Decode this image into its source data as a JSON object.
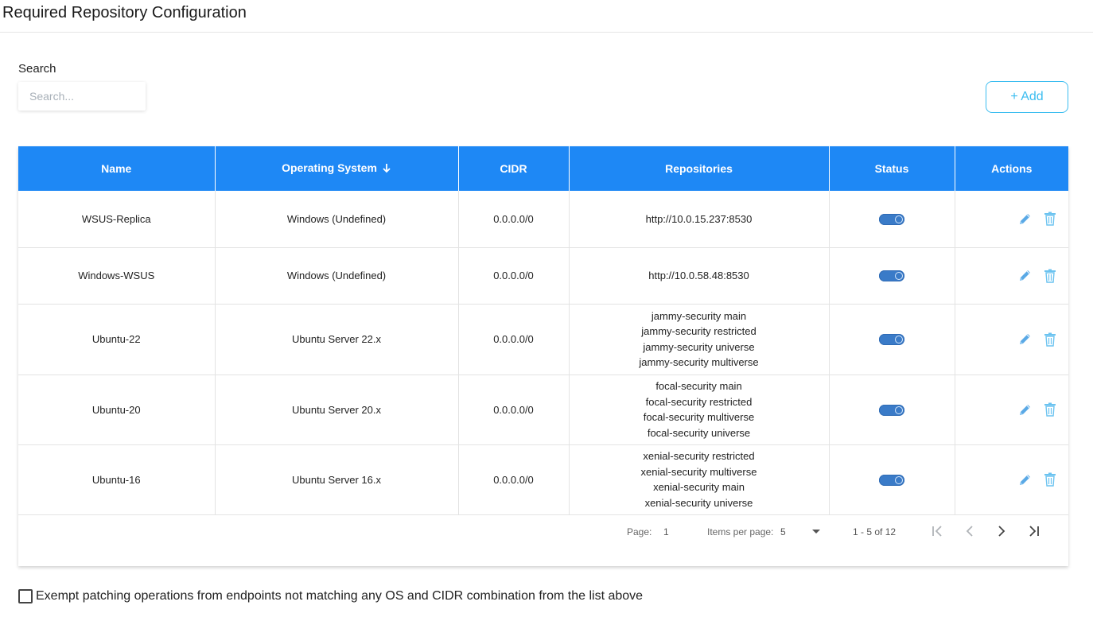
{
  "page": {
    "title": "Required Repository Configuration"
  },
  "search": {
    "label": "Search",
    "placeholder": "Search...",
    "value": ""
  },
  "toolbar": {
    "add_label": "+ Add"
  },
  "colors": {
    "header_bg": "#1e88f5",
    "accent": "#3cbdf0",
    "toggle": "#3a7bc8"
  },
  "table": {
    "columns": [
      "Name",
      "Operating System",
      "CIDR",
      "Repositories",
      "Status",
      "Actions"
    ],
    "sort": {
      "column": "Operating System",
      "direction": "descending",
      "icon": "arrow-down-icon"
    },
    "rows": [
      {
        "name": "WSUS-Replica",
        "os": "Windows (Undefined)",
        "cidr": "0.0.0.0/0",
        "repositories": [
          "http://10.0.15.237:8530"
        ],
        "status": "enabled"
      },
      {
        "name": "Windows-WSUS",
        "os": "Windows (Undefined)",
        "cidr": "0.0.0.0/0",
        "repositories": [
          "http://10.0.58.48:8530"
        ],
        "status": "enabled"
      },
      {
        "name": "Ubuntu-22",
        "os": "Ubuntu Server 22.x",
        "cidr": "0.0.0.0/0",
        "repositories": [
          "jammy-security main",
          "jammy-security restricted",
          "jammy-security universe",
          "jammy-security multiverse"
        ],
        "status": "enabled"
      },
      {
        "name": "Ubuntu-20",
        "os": "Ubuntu Server 20.x",
        "cidr": "0.0.0.0/0",
        "repositories": [
          "focal-security main",
          "focal-security restricted",
          "focal-security multiverse",
          "focal-security universe"
        ],
        "status": "enabled"
      },
      {
        "name": "Ubuntu-16",
        "os": "Ubuntu Server 16.x",
        "cidr": "0.0.0.0/0",
        "repositories": [
          "xenial-security restricted",
          "xenial-security multiverse",
          "xenial-security main",
          "xenial-security universe"
        ],
        "status": "enabled"
      }
    ],
    "row_actions": [
      "pencil-icon",
      "trash-icon"
    ]
  },
  "paginator": {
    "page_label": "Page:",
    "page_value": "1",
    "items_per_page_label": "Items per page:",
    "items_per_page_value": "5",
    "range": "1 - 5 of 12",
    "buttons": [
      "first-page-icon",
      "previous-page-icon",
      "next-page-icon",
      "last-page-icon"
    ]
  },
  "exempt": {
    "label": "Exempt patching operations from endpoints not matching any OS and CIDR combination from the list above",
    "checked": false
  }
}
